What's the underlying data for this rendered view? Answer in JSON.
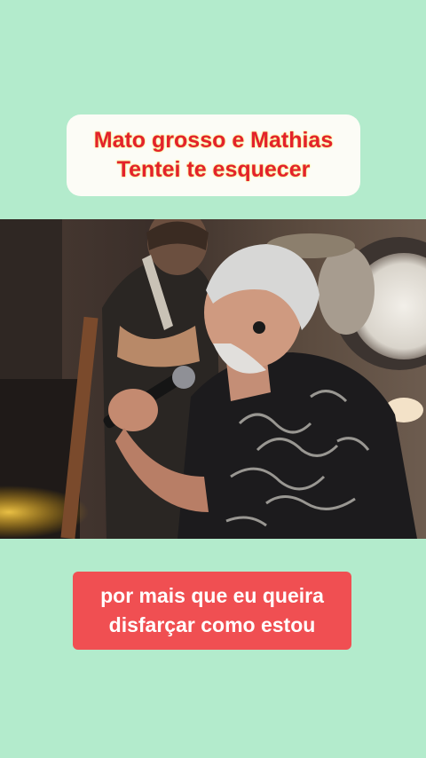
{
  "title_card": {
    "line1": "Mato grosso e Mathias",
    "line2": "Tentei te esquecer"
  },
  "lyric_card": {
    "line1": "por mais que eu queira",
    "line2": "disfarçar como estou"
  },
  "colors": {
    "background": "#b3ebcc",
    "title_text": "#e3222c",
    "title_glow": "#f6e35a",
    "lyric_card": "#f04f52",
    "lyric_text": "#ffffff"
  }
}
